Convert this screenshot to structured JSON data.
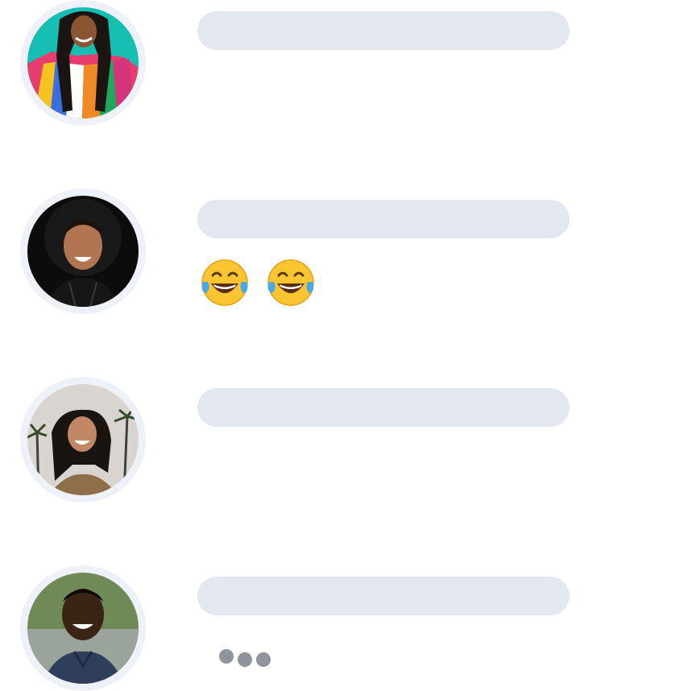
{
  "messages": [
    {
      "avatar": "avatar-woman-colorful-top",
      "reaction": ""
    },
    {
      "avatar": "avatar-man-black-hat",
      "reaction": "😂😂"
    },
    {
      "avatar": "avatar-woman-palm-trees",
      "reaction": ""
    },
    {
      "avatar": "avatar-man-smiling-outdoors",
      "reaction": ""
    }
  ],
  "reaction_emoji_name": "face-with-tears-of-joy",
  "typing_indicator": {
    "dots": 3,
    "color": "#8e939c"
  },
  "colors": {
    "bubble": "#e3e7ef",
    "avatar_ring": "#eef2f8",
    "background": "#ffffff"
  }
}
